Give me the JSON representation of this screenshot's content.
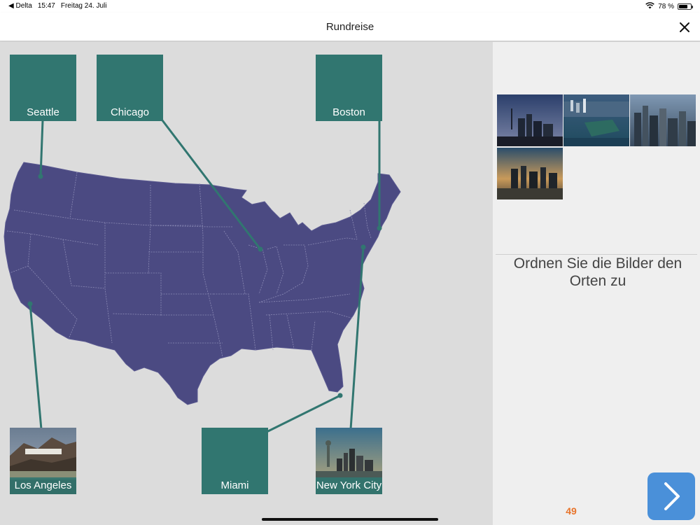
{
  "status": {
    "back_app": "◀ Delta",
    "time": "15:47",
    "date": "Freitag 24. Juli",
    "battery": "78 %",
    "battery_level": 0.78
  },
  "nav": {
    "title": "Rundreise",
    "close_icon": "close-icon"
  },
  "cities": {
    "seattle": "Seattle",
    "chicago": "Chicago",
    "boston": "Boston",
    "los_angeles": "Los Angeles",
    "miami": "Miami",
    "new_york": "New York City"
  },
  "panel": {
    "instruction": "Ordnen Sie die Bilder den Orten zu",
    "page": "49",
    "next_icon": "chevron-right-icon"
  },
  "colors": {
    "tile": "#317670",
    "map": "#4b4a82",
    "accent": "#e8742b",
    "next": "#4a90d9"
  }
}
